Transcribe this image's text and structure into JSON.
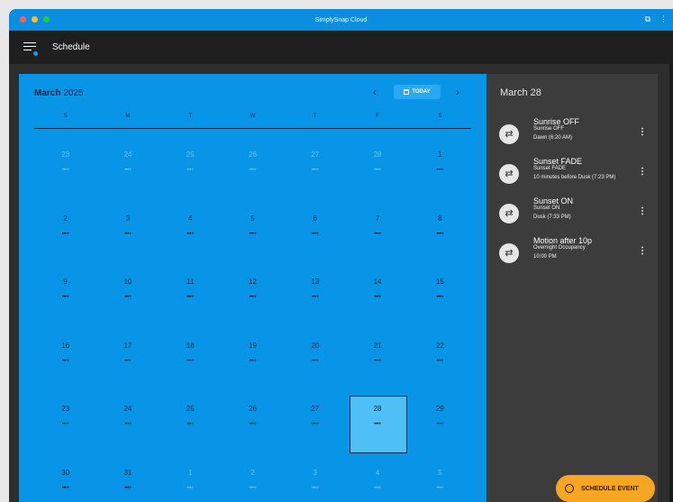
{
  "window": {
    "title": "SimplySnap Cloud",
    "traffic_colors": [
      "#ff5f57",
      "#febc2e",
      "#28c840"
    ]
  },
  "appbar": {
    "title": "Schedule"
  },
  "calendar": {
    "month": "March",
    "year": "2025",
    "prev_label": "‹",
    "next_label": "›",
    "today_label": "TODAY",
    "weekdays": [
      "S",
      "M",
      "T",
      "W",
      "T",
      "F",
      "S"
    ],
    "dots": "•••+",
    "weeks": [
      [
        {
          "d": "23",
          "muted": true
        },
        {
          "d": "24",
          "muted": true
        },
        {
          "d": "25",
          "muted": true
        },
        {
          "d": "26",
          "muted": true
        },
        {
          "d": "27",
          "muted": true
        },
        {
          "d": "28",
          "muted": true
        },
        {
          "d": "1"
        }
      ],
      [
        {
          "d": "2"
        },
        {
          "d": "3"
        },
        {
          "d": "4"
        },
        {
          "d": "5"
        },
        {
          "d": "6"
        },
        {
          "d": "7"
        },
        {
          "d": "8"
        }
      ],
      [
        {
          "d": "9"
        },
        {
          "d": "10"
        },
        {
          "d": "11"
        },
        {
          "d": "12"
        },
        {
          "d": "13"
        },
        {
          "d": "14"
        },
        {
          "d": "15"
        }
      ],
      [
        {
          "d": "16"
        },
        {
          "d": "17"
        },
        {
          "d": "18"
        },
        {
          "d": "19"
        },
        {
          "d": "20"
        },
        {
          "d": "21"
        },
        {
          "d": "22"
        }
      ],
      [
        {
          "d": "23"
        },
        {
          "d": "24"
        },
        {
          "d": "25"
        },
        {
          "d": "26"
        },
        {
          "d": "27"
        },
        {
          "d": "28",
          "selected": true
        },
        {
          "d": "29"
        }
      ],
      [
        {
          "d": "30"
        },
        {
          "d": "31"
        },
        {
          "d": "1",
          "muted": true
        },
        {
          "d": "2",
          "muted": true
        },
        {
          "d": "3",
          "muted": true
        },
        {
          "d": "4",
          "muted": true
        },
        {
          "d": "5",
          "muted": true
        }
      ]
    ]
  },
  "side": {
    "date": "March 28",
    "events": [
      {
        "title": "Sunrise OFF",
        "sub": "Sunrise OFF",
        "time": "Dawn (6:20 AM)",
        "icon": "repeat-icon"
      },
      {
        "title": "Sunset FADE",
        "sub": "Sunset FADE",
        "time": "10 minutes before Dusk (7:23 PM)",
        "icon": "repeat-icon"
      },
      {
        "title": "Sunset ON",
        "sub": "Sunset ON",
        "time": "Dusk (7:33 PM)",
        "icon": "repeat-icon"
      },
      {
        "title": "Motion after 10p",
        "sub": "Overnight Occupancy",
        "time": "10:00 PM",
        "icon": "repeat-icon"
      }
    ]
  },
  "fab": {
    "label": "SCHEDULE EVENT",
    "icon": "clock-icon",
    "color": "#f6a623"
  },
  "colors": {
    "calendar_bg": "#0895e8",
    "titlebar": "#0a8fe0",
    "appbar": "#1f1f1f",
    "side_panel": "#3c3c3c"
  }
}
